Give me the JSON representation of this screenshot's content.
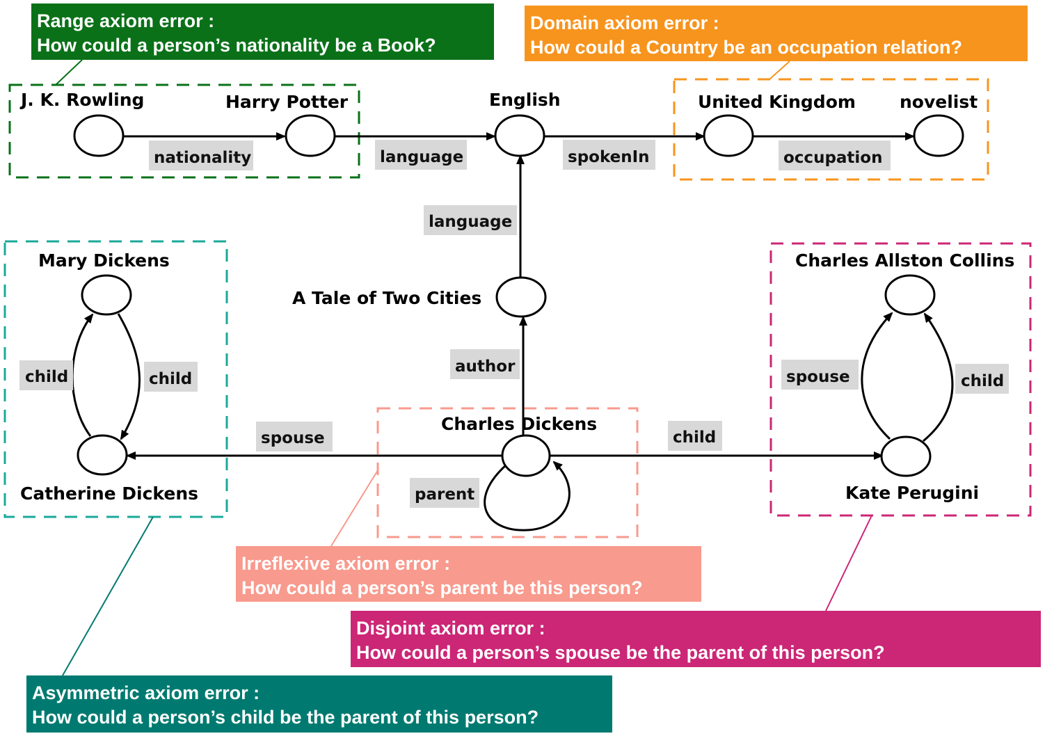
{
  "colors": {
    "range": "#0a7118",
    "domain": "#f7941d",
    "irreflexive": "#f89a8d",
    "disjoint": "#cc2676",
    "asymmetric": "#007a70",
    "asymmetric_box": "#1aa99a",
    "edge": "#000000",
    "edge_label_bg": "#d8d8d8"
  },
  "nodes": {
    "jk_rowling": "J. K. Rowling",
    "harry_potter": "Harry Potter",
    "english": "English",
    "united_kingdom": "United Kingdom",
    "novelist": "novelist",
    "mary_dickens": "Mary Dickens",
    "catherine_dickens": "Catherine Dickens",
    "tale_of_two_cities": "A Tale of Two Cities",
    "charles_dickens": "Charles Dickens",
    "charles_allston_collins": "Charles Allston Collins",
    "kate_perugini": "Kate Perugini"
  },
  "edges": {
    "nationality": "nationality",
    "language_hp": "language",
    "spoken_in": "spokenIn",
    "occupation": "occupation",
    "language_tale": "language",
    "author": "author",
    "spouse_cd": "spouse",
    "child_cd": "child",
    "parent_self": "parent",
    "child_md_left": "child",
    "child_md_right": "child",
    "spouse_kp": "spouse",
    "child_kp": "child"
  },
  "callouts": {
    "range": {
      "title": "Range axiom error :",
      "question": "How could a person’s nationality be a Book?"
    },
    "domain": {
      "title": "Domain axiom error :",
      "question": "How could a Country be an occupation relation?"
    },
    "irreflexive": {
      "title": "Irreflexive axiom error :",
      "question": "How could a person’s parent be this person?"
    },
    "disjoint": {
      "title": "Disjoint axiom error :",
      "question": "How could a person’s spouse be the parent of this person?"
    },
    "asymmetric": {
      "title": "Asymmetric axiom error :",
      "question": "How could a person’s child be the parent of this person?"
    }
  }
}
